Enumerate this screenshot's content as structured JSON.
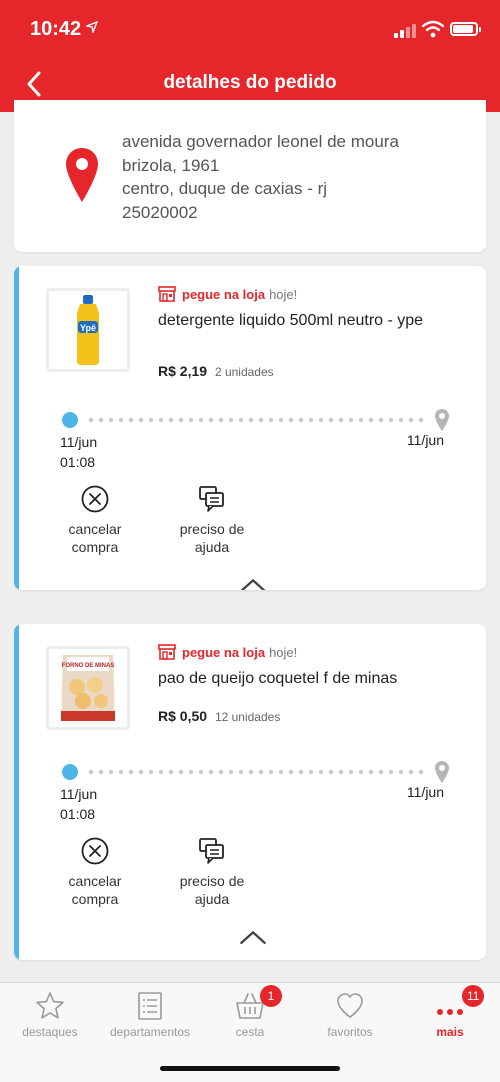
{
  "status_bar": {
    "time": "10:42"
  },
  "header": {
    "title": "detalhes do pedido"
  },
  "address": {
    "lines": [
      "avenida governador leonel de moura",
      "brizola, 1961",
      "centro, duque de caxias - rj",
      "25020002"
    ]
  },
  "orders": [
    {
      "store_label": "pegue na loja",
      "store_when": "hoje!",
      "product_name": "detergente liquido 500ml neutro - ype",
      "price": "R$ 2,19",
      "units": "2 unidades",
      "start_date": "11/jun",
      "start_time": "01:08",
      "end_date": "11/jun",
      "cancel_label_1": "cancelar",
      "cancel_label_2": "compra",
      "help_label_1": "preciso de",
      "help_label_2": "ajuda",
      "thumb_text": "Ypê"
    },
    {
      "store_label": "pegue na loja",
      "store_when": "hoje!",
      "product_name": "pao de queijo coquetel f de minas",
      "price": "R$ 0,50",
      "units": "12 unidades",
      "start_date": "11/jun",
      "start_time": "01:08",
      "end_date": "11/jun",
      "cancel_label_1": "cancelar",
      "cancel_label_2": "compra",
      "help_label_1": "preciso de",
      "help_label_2": "ajuda",
      "thumb_text": "FORNO DE MINAS"
    }
  ],
  "nav": {
    "items": [
      {
        "label": "destaques",
        "icon": "star-icon"
      },
      {
        "label": "departamentos",
        "icon": "list-icon"
      },
      {
        "label": "cesta",
        "icon": "basket-icon",
        "badge": "1"
      },
      {
        "label": "favoritos",
        "icon": "heart-icon"
      },
      {
        "label": "mais",
        "icon": "more-icon",
        "badge": "11"
      }
    ]
  },
  "colors": {
    "brand": "#e5262b",
    "timeline": "#4cb6e8"
  }
}
